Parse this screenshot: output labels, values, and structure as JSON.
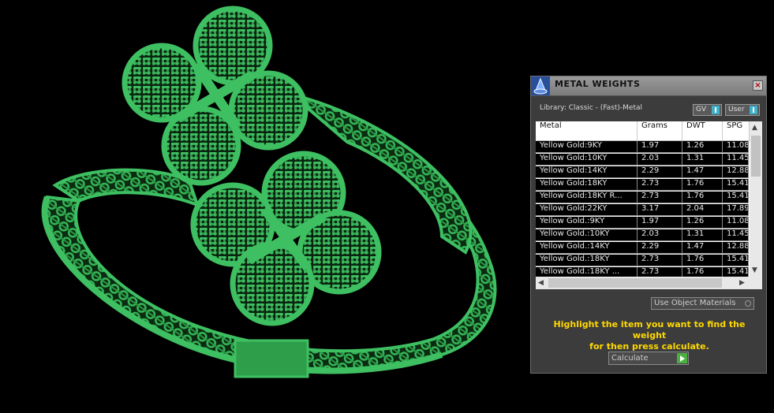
{
  "panel": {
    "title": "METAL WEIGHTS",
    "close_label": "×",
    "library_label": "Library: Classic - (Fast)-Metal",
    "toggles": {
      "gv": "GV",
      "user": "User"
    },
    "columns": [
      "Metal",
      "Grams",
      "DWT",
      "SPG"
    ],
    "rows": [
      [
        "Yellow Gold:9KY",
        "1.97",
        "1.26",
        "11.08"
      ],
      [
        "Yellow Gold:10KY",
        "2.03",
        "1.31",
        "11.45"
      ],
      [
        "Yellow Gold:14KY",
        "2.29",
        "1.47",
        "12.88"
      ],
      [
        "Yellow Gold:18KY",
        "2.73",
        "1.76",
        "15.41"
      ],
      [
        "Yellow Gold:18KY R...",
        "2.73",
        "1.76",
        "15.41"
      ],
      [
        "Yellow Gold:22KY",
        "3.17",
        "2.04",
        "17.89"
      ],
      [
        "Yellow Gold.:9KY",
        "1.97",
        "1.26",
        "11.08"
      ],
      [
        "Yellow Gold.:10KY",
        "2.03",
        "1.31",
        "11.45"
      ],
      [
        "Yellow Gold.:14KY",
        "2.29",
        "1.47",
        "12.88"
      ],
      [
        "Yellow Gold.:18KY",
        "2.73",
        "1.76",
        "15.41"
      ],
      [
        "Yellow Gold.:18KY ...",
        "2.73",
        "1.76",
        "15.41"
      ]
    ],
    "use_object_materials": "Use Object Materials",
    "instruction_line1": "Highlight the item you want to find the weight",
    "instruction_line2": "for then press calculate.",
    "calculate_label": "Calculate",
    "colors": {
      "instruction": "#ffd800",
      "accent_toggle": "#3fb0c8",
      "go_button": "#4ab13f",
      "model": "#2e9e4a"
    }
  },
  "viewport": {
    "content": "3D ring model render",
    "icon": "ring-model"
  }
}
